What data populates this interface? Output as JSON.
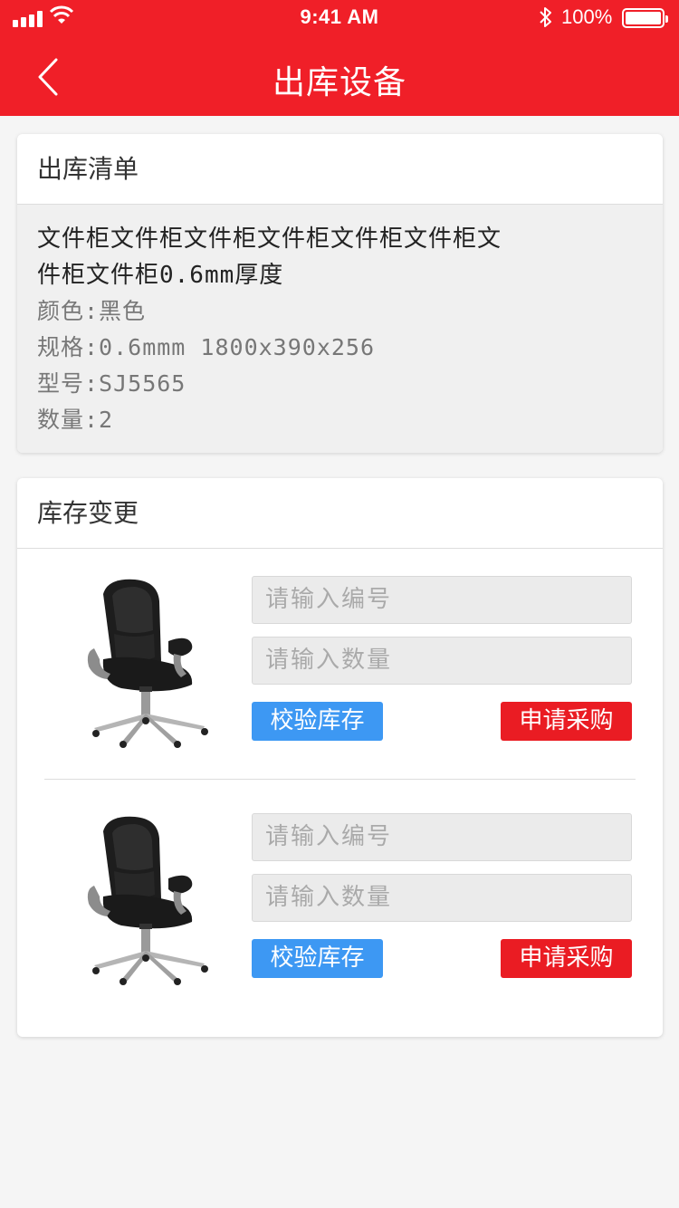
{
  "status_bar": {
    "time": "9:41 AM",
    "battery": "100%"
  },
  "nav": {
    "title": "出库设备"
  },
  "checkout_list": {
    "header": "出库清单",
    "name_line1": "文件柜文件柜文件柜文件柜文件柜文件柜文",
    "name_line2": "件柜文件柜0.6mm厚度",
    "color": "颜色:黑色",
    "spec": "规格:0.6mmm 1800x390x256",
    "model": "型号:SJ5565",
    "quantity": "数量:2"
  },
  "inventory": {
    "header": "库存变更",
    "items": [
      {
        "code_placeholder": "请输入编号",
        "qty_placeholder": "请输入数量",
        "verify_label": "校验库存",
        "purchase_label": "申请采购"
      },
      {
        "code_placeholder": "请输入编号",
        "qty_placeholder": "请输入数量",
        "verify_label": "校验库存",
        "purchase_label": "申请采购"
      }
    ]
  },
  "colors": {
    "brand_red": "#f01f28",
    "verify_blue": "#3d98f3",
    "purchase_red": "#ea1c23"
  },
  "icons": {
    "back": "chevron-left-icon",
    "product": "office-chair-image"
  }
}
